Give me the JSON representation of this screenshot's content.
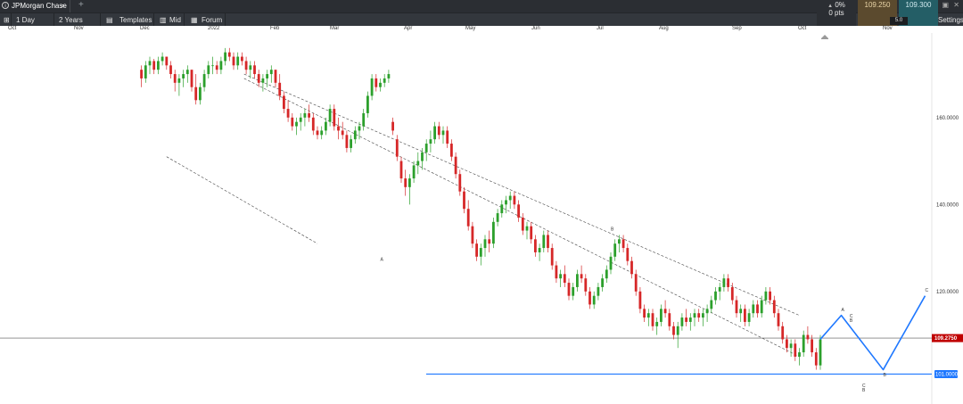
{
  "header": {
    "instrument": "JPMorgan Chase",
    "add_tab": "+",
    "interval": "1 Day",
    "range": "2 Years",
    "templates": "Templates",
    "price_mode": "Mid",
    "forum": "Forum",
    "settings": "Settings"
  },
  "quote": {
    "change_pct": "0%",
    "change_pts": "0 pts",
    "bid": "109.250",
    "ask": "109.300",
    "spread": "5.0"
  },
  "colors": {
    "up": "#2ca02c",
    "down": "#d62728",
    "projection": "#1f78ff",
    "price_tag": "#c00000"
  },
  "chart_data": {
    "type": "candlestick",
    "x_ticks": [
      "Oct",
      "Nov",
      "Dec",
      "2022",
      "Feb",
      "Mar",
      "Apr",
      "May",
      "Jun",
      "Jul",
      "Aug",
      "Sep",
      "Oct",
      "Nov"
    ],
    "y_ticks": [
      "160.0000",
      "140.0000",
      "120.0000"
    ],
    "ylim": [
      99,
      176
    ],
    "current_price": 109.275,
    "current_price_label": "109.2750",
    "support_level": 101.0,
    "support_label": "101.0000",
    "candles": [
      [
        171,
        172,
        167,
        169
      ],
      [
        169,
        173,
        168,
        172
      ],
      [
        172,
        174,
        170,
        173
      ],
      [
        173,
        173.5,
        170,
        171
      ],
      [
        171,
        174,
        170,
        173
      ],
      [
        173,
        175,
        172,
        174
      ],
      [
        174,
        174,
        171,
        172
      ],
      [
        172,
        173,
        169,
        170
      ],
      [
        170,
        171,
        166,
        168
      ],
      [
        168,
        170,
        165,
        169
      ],
      [
        169,
        171,
        167,
        170
      ],
      [
        170,
        172,
        168,
        171
      ],
      [
        171,
        171,
        166,
        167
      ],
      [
        167,
        170,
        163,
        164
      ],
      [
        164,
        168,
        163,
        167
      ],
      [
        167,
        171,
        166,
        170
      ],
      [
        170,
        173,
        169,
        172
      ],
      [
        172,
        174,
        170,
        172
      ],
      [
        172,
        173,
        170,
        171
      ],
      [
        171,
        174,
        170,
        173
      ],
      [
        173,
        176,
        172,
        175
      ],
      [
        175,
        176,
        173,
        174
      ],
      [
        174,
        175,
        171,
        172
      ],
      [
        172,
        175,
        171,
        174
      ],
      [
        174,
        175,
        172,
        173
      ],
      [
        173,
        174,
        170,
        171
      ],
      [
        171,
        173,
        169,
        172
      ],
      [
        172,
        173,
        169,
        170
      ],
      [
        170,
        171,
        167,
        168
      ],
      [
        168,
        170,
        166,
        169
      ],
      [
        169,
        171,
        167,
        170
      ],
      [
        170,
        172,
        168,
        171
      ],
      [
        171,
        171,
        167,
        168
      ],
      [
        168,
        170,
        164,
        165
      ],
      [
        165,
        166,
        161,
        162
      ],
      [
        162,
        164,
        159,
        160
      ],
      [
        160,
        161,
        157,
        158
      ],
      [
        158,
        160,
        156,
        159
      ],
      [
        159,
        161,
        157,
        160
      ],
      [
        160,
        162,
        158,
        161
      ],
      [
        161,
        163,
        159,
        160
      ],
      [
        160,
        161,
        156,
        157
      ],
      [
        157,
        158,
        155,
        156
      ],
      [
        156,
        158,
        155,
        157
      ],
      [
        157,
        160,
        156,
        159
      ],
      [
        159,
        163,
        158,
        162
      ],
      [
        162,
        163,
        157,
        158
      ],
      [
        158,
        160,
        155,
        157
      ],
      [
        157,
        159,
        155,
        156
      ],
      [
        156,
        157,
        152,
        153
      ],
      [
        153,
        156,
        152,
        155
      ],
      [
        155,
        158,
        154,
        157
      ],
      [
        157,
        159,
        155,
        158
      ],
      [
        158,
        162,
        157,
        161
      ],
      [
        161,
        166,
        160,
        165
      ],
      [
        165,
        170,
        164,
        169
      ],
      [
        169,
        170,
        166,
        167
      ],
      [
        167,
        169,
        166,
        168
      ],
      [
        168,
        170,
        167,
        169
      ],
      [
        169,
        171,
        168,
        170
      ],
      [
        159,
        160,
        156,
        157
      ],
      [
        155,
        156,
        150,
        151
      ],
      [
        150,
        151,
        145,
        146
      ],
      [
        146,
        148,
        142,
        144
      ],
      [
        144,
        147,
        140,
        146
      ],
      [
        146,
        150,
        145,
        149
      ],
      [
        149,
        152,
        147,
        150
      ],
      [
        150,
        153,
        148,
        152
      ],
      [
        152,
        155,
        150,
        154
      ],
      [
        154,
        157,
        152,
        155
      ],
      [
        155,
        159,
        154,
        158
      ],
      [
        158,
        159,
        155,
        156
      ],
      [
        156,
        158,
        154,
        157
      ],
      [
        157,
        158,
        153,
        154
      ],
      [
        154,
        155,
        150,
        151
      ],
      [
        151,
        152,
        146,
        147
      ],
      [
        147,
        148,
        142,
        143
      ],
      [
        143,
        144,
        138,
        139
      ],
      [
        139,
        141,
        134,
        135
      ],
      [
        135,
        136,
        130,
        131
      ],
      [
        131,
        132,
        127,
        128
      ],
      [
        128,
        131,
        126,
        130
      ],
      [
        130,
        133,
        128,
        132
      ],
      [
        132,
        134,
        129,
        131
      ],
      [
        131,
        137,
        130,
        136
      ],
      [
        136,
        139,
        135,
        138
      ],
      [
        138,
        141,
        137,
        140
      ],
      [
        140,
        142,
        138,
        141
      ],
      [
        141,
        143,
        139,
        142
      ],
      [
        142,
        143,
        139,
        140
      ],
      [
        140,
        141,
        136,
        137
      ],
      [
        137,
        138,
        133,
        134
      ],
      [
        134,
        136,
        132,
        135
      ],
      [
        135,
        136,
        131,
        132
      ],
      [
        132,
        133,
        128,
        129
      ],
      [
        129,
        131,
        127,
        130
      ],
      [
        130,
        134,
        129,
        133
      ],
      [
        133,
        134,
        129,
        130
      ],
      [
        130,
        131,
        125,
        126
      ],
      [
        126,
        127,
        122,
        123
      ],
      [
        123,
        125,
        121,
        124
      ],
      [
        124,
        126,
        121,
        122
      ],
      [
        122,
        123,
        118,
        119
      ],
      [
        119,
        122,
        118,
        121
      ],
      [
        121,
        125,
        120,
        124
      ],
      [
        124,
        126,
        122,
        123
      ],
      [
        123,
        124,
        119,
        120
      ],
      [
        120,
        121,
        116,
        117
      ],
      [
        117,
        120,
        116,
        119
      ],
      [
        119,
        122,
        118,
        121
      ],
      [
        121,
        124,
        120,
        123
      ],
      [
        123,
        126,
        122,
        125
      ],
      [
        125,
        129,
        124,
        128
      ],
      [
        128,
        132,
        127,
        131
      ],
      [
        131,
        133,
        129,
        132
      ],
      [
        132,
        133,
        129,
        130
      ],
      [
        130,
        131,
        126,
        127
      ],
      [
        127,
        128,
        123,
        124
      ],
      [
        124,
        125,
        119,
        120
      ],
      [
        120,
        121,
        115,
        116
      ],
      [
        116,
        117,
        113,
        114
      ],
      [
        114,
        116,
        112,
        115
      ],
      [
        115,
        116,
        111,
        112
      ],
      [
        112,
        114,
        110,
        113
      ],
      [
        113,
        117,
        112,
        116
      ],
      [
        116,
        118,
        114,
        115
      ],
      [
        115,
        116,
        111,
        112
      ],
      [
        112,
        113,
        109,
        110
      ],
      [
        110,
        113,
        107,
        112
      ],
      [
        112,
        115,
        111,
        114
      ],
      [
        114,
        116,
        112,
        113
      ],
      [
        113,
        115,
        111,
        114
      ],
      [
        114,
        116,
        112,
        115
      ],
      [
        115,
        116,
        113,
        114
      ],
      [
        114,
        116,
        112,
        115
      ],
      [
        115,
        117,
        113,
        116
      ],
      [
        116,
        119,
        115,
        118
      ],
      [
        118,
        121,
        117,
        120
      ],
      [
        120,
        122,
        118,
        121
      ],
      [
        121,
        124,
        120,
        123
      ],
      [
        123,
        124,
        120,
        121
      ],
      [
        121,
        122,
        117,
        118
      ],
      [
        118,
        119,
        114,
        115
      ],
      [
        115,
        117,
        113,
        116
      ],
      [
        116,
        117,
        112,
        113
      ],
      [
        113,
        116,
        112,
        115
      ],
      [
        115,
        118,
        114,
        117
      ],
      [
        117,
        118,
        114,
        115
      ],
      [
        115,
        119,
        114,
        118
      ],
      [
        118,
        121,
        117,
        120
      ],
      [
        120,
        121,
        117,
        118
      ],
      [
        118,
        119,
        114,
        115
      ],
      [
        115,
        116,
        111,
        112
      ],
      [
        112,
        113,
        108,
        109
      ],
      [
        109,
        110,
        106,
        107
      ],
      [
        107,
        109,
        105,
        108
      ],
      [
        108,
        109,
        104,
        105
      ],
      [
        105,
        107,
        103,
        106
      ],
      [
        106,
        111,
        105,
        110
      ],
      [
        110,
        112,
        108,
        109
      ],
      [
        109,
        110,
        105,
        106
      ],
      [
        106,
        107,
        102,
        103
      ],
      [
        103,
        110,
        102,
        109
      ]
    ],
    "channels": [
      {
        "style": "dashed",
        "points": [
          [
            -137.5,
            169
          ],
          [
            -5,
            105
          ]
        ]
      },
      {
        "style": "dashed",
        "points": [
          [
            -137.5,
            170
          ],
          [
            -5,
            114.5
          ]
        ]
      },
      {
        "style": "dashed",
        "points": [
          [
            -156,
            151
          ],
          [
            -120,
            131
          ]
        ]
      }
    ],
    "wave_projection": [
      [
        0,
        109
      ],
      [
        5,
        114.5
      ],
      [
        15,
        102
      ],
      [
        25,
        119
      ]
    ],
    "wave_labels": [
      {
        "text": "A",
        "at": [
          -105,
          127
        ]
      },
      {
        "text": "B",
        "at": [
          -50,
          134
        ]
      },
      {
        "text": "A",
        "at": [
          5,
          115.5
        ]
      },
      {
        "text": "B",
        "at": [
          15,
          100.5
        ]
      },
      {
        "text": "C",
        "at": [
          25,
          120
        ]
      },
      {
        "text": "B",
        "at": [
          7,
          113
        ]
      },
      {
        "text": "C",
        "at": [
          7,
          114
        ]
      },
      {
        "text": "B",
        "at": [
          10,
          97
        ]
      },
      {
        "text": "C",
        "at": [
          10,
          98
        ]
      }
    ]
  }
}
